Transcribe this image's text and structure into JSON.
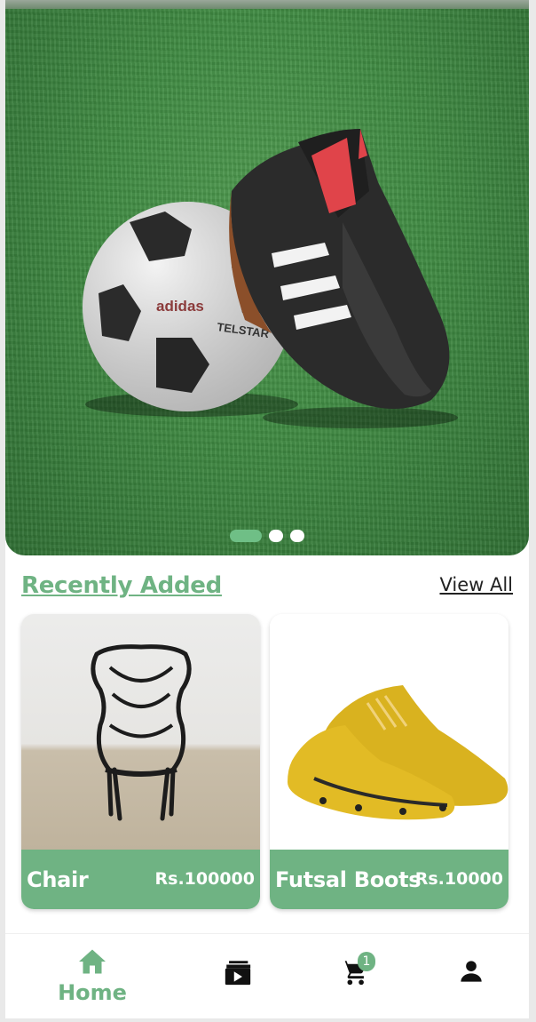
{
  "hero": {
    "ball_brand": "adidas",
    "ball_model": "TELSTAR",
    "carousel_slides": 3,
    "active_slide": 1
  },
  "recent": {
    "title": "Recently Added",
    "view_all": "View All"
  },
  "products": [
    {
      "name": "Chair",
      "price": "Rs.100000",
      "icon": "chair-image"
    },
    {
      "name": "Futsal Boots",
      "price": "Rs.10000",
      "icon": "boots-image"
    }
  ],
  "nav": {
    "home_label": "Home",
    "cart_count": "1",
    "items": [
      "home-icon",
      "video-library-icon",
      "cart-icon",
      "person-icon"
    ]
  },
  "colors": {
    "accent": "#6fb383",
    "text": "#222222"
  }
}
